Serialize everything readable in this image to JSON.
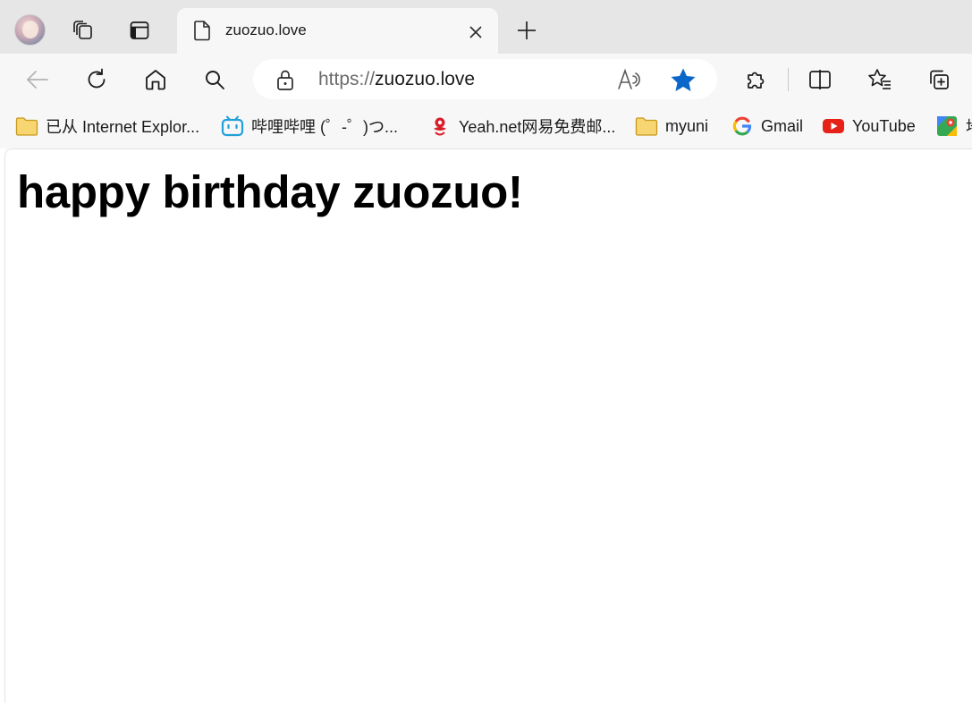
{
  "tab": {
    "title": "zuozuo.love"
  },
  "address": {
    "scheme": "https://",
    "host": "zuozuo.love"
  },
  "favorites": [
    {
      "label": "已从 Internet Explor...",
      "icon": "folder-icon"
    },
    {
      "label": "哔哩哔哩 (゜-゜)つ...",
      "icon": "bilibili-icon"
    },
    {
      "label": "Yeah.net网易免费邮...",
      "icon": "netease-icon"
    },
    {
      "label": "myuni",
      "icon": "folder-icon"
    },
    {
      "label": "Gmail",
      "icon": "google-icon"
    },
    {
      "label": "YouTube",
      "icon": "youtube-icon"
    },
    {
      "label": "地",
      "icon": "maps-icon"
    }
  ],
  "content": {
    "heading": "happy birthday zuozuo!"
  },
  "colors": {
    "accent": "#0a66c8",
    "tabbar": "#e6e6e6",
    "toolbar": "#f7f7f7"
  }
}
